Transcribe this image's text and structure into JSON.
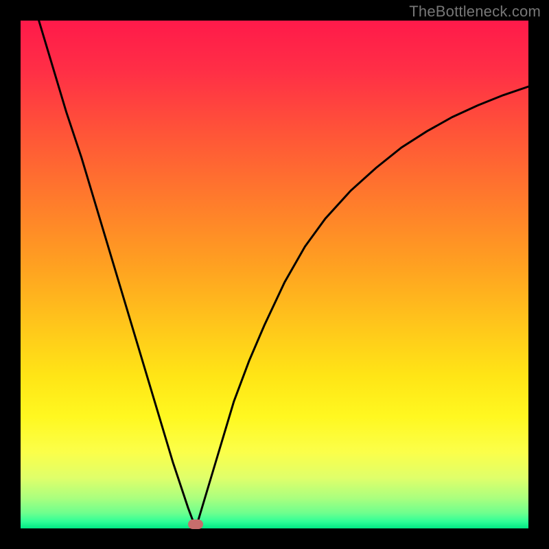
{
  "watermark": "TheBottleneck.com",
  "chart_data": {
    "type": "line",
    "title": "",
    "xlabel": "",
    "ylabel": "",
    "xlim": [
      0,
      1
    ],
    "ylim": [
      0,
      1
    ],
    "x": [
      0.0,
      0.03,
      0.06,
      0.09,
      0.12,
      0.15,
      0.18,
      0.21,
      0.24,
      0.27,
      0.3,
      0.33,
      0.345,
      0.36,
      0.39,
      0.42,
      0.45,
      0.48,
      0.52,
      0.56,
      0.6,
      0.65,
      0.7,
      0.75,
      0.8,
      0.85,
      0.9,
      0.95,
      1.0
    ],
    "values": [
      1.12,
      1.02,
      0.92,
      0.82,
      0.73,
      0.63,
      0.53,
      0.43,
      0.33,
      0.23,
      0.13,
      0.04,
      0.0,
      0.05,
      0.15,
      0.25,
      0.33,
      0.4,
      0.485,
      0.555,
      0.61,
      0.665,
      0.71,
      0.75,
      0.782,
      0.81,
      0.833,
      0.853,
      0.87
    ],
    "minimum": {
      "x": 0.345,
      "y": 0.0
    },
    "marker_color": "#c86d6c",
    "background_gradient": {
      "stops": [
        {
          "offset": 0.0,
          "color": "#ff1a4a"
        },
        {
          "offset": 0.1,
          "color": "#ff2f46"
        },
        {
          "offset": 0.22,
          "color": "#ff5438"
        },
        {
          "offset": 0.35,
          "color": "#ff7a2c"
        },
        {
          "offset": 0.48,
          "color": "#ffa021"
        },
        {
          "offset": 0.6,
          "color": "#ffc61b"
        },
        {
          "offset": 0.7,
          "color": "#ffe516"
        },
        {
          "offset": 0.78,
          "color": "#fff820"
        },
        {
          "offset": 0.85,
          "color": "#fbff4a"
        },
        {
          "offset": 0.9,
          "color": "#e0ff6a"
        },
        {
          "offset": 0.94,
          "color": "#abff7e"
        },
        {
          "offset": 0.97,
          "color": "#6dff8e"
        },
        {
          "offset": 0.987,
          "color": "#2eff97"
        },
        {
          "offset": 1.0,
          "color": "#00e884"
        }
      ]
    }
  }
}
